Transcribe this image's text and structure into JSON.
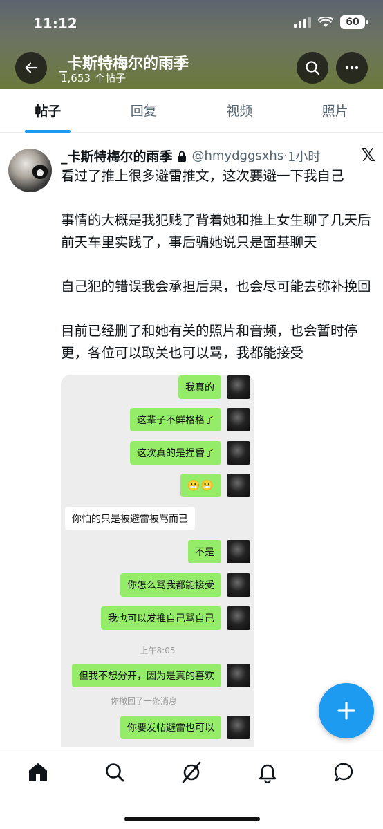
{
  "status_bar": {
    "time": "11:12",
    "battery": "60"
  },
  "header": {
    "title": "_卡斯特梅尔的雨季",
    "post_count": "1,653",
    "post_count_label": "个帖子"
  },
  "tabs": [
    {
      "label": "帖子",
      "active": true
    },
    {
      "label": "回复",
      "active": false
    },
    {
      "label": "视频",
      "active": false
    },
    {
      "label": "照片",
      "active": false
    }
  ],
  "post": {
    "display_name": "_卡斯特梅尔的雨季",
    "handle": "@hmydggsxhs",
    "separator": "·",
    "time": "1小时",
    "x_logo": "𝕏",
    "paragraphs": [
      "看过了推上很多避雷推文，这次要避一下我自己",
      "事情的大概是我犯贱了背着她和推上女生聊了几天后前天车里实践了，事后骗她说只是面基聊天",
      "自己犯的错误我会承担后果，也会尽可能去弥补挽回",
      "目前已经删了和她有关的照片和音频，也会暂时停更，各位可以取关也可以骂，我都能接受"
    ]
  },
  "chat": {
    "messages": [
      {
        "side": "right",
        "text": "我真的"
      },
      {
        "side": "right",
        "text": "这辈子不鲜格格了"
      },
      {
        "side": "right",
        "text": "这次真的是捏昏了"
      },
      {
        "side": "right",
        "text": "😬😬"
      },
      {
        "side": "left",
        "text": "你怕的只是被避雷被骂而已"
      },
      {
        "side": "right",
        "text": "不是"
      },
      {
        "side": "right",
        "text": "你怎么骂我都能接受"
      },
      {
        "side": "right",
        "text": "我也可以发推自己骂自己"
      },
      {
        "side": "right",
        "text": "但我不想分开，因为是真的喜欢"
      },
      {
        "side": "right",
        "text": "你要发帖避雷也可以"
      }
    ],
    "timestamp": "上午8:05",
    "recall_notice": "你撤回了一条消息"
  },
  "icons": {
    "back": "back-arrow-icon",
    "search": "search-icon",
    "more": "more-dots-icon",
    "lock": "lock-icon",
    "compose": "plus-icon",
    "nav": [
      "home-icon",
      "search-icon",
      "grok-icon",
      "bell-icon",
      "message-icon"
    ]
  },
  "colors": {
    "accent": "#1d9bf0",
    "wechat_green": "#95ec69"
  }
}
